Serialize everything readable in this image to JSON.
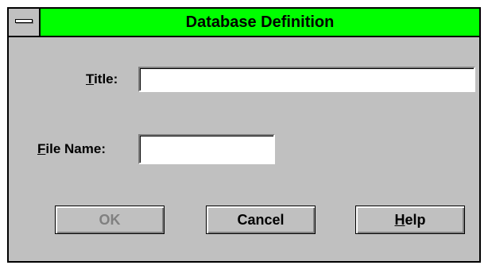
{
  "dialog": {
    "title": "Database Definition",
    "title_color": "#00ff00",
    "background_color": "#c0c0c0"
  },
  "fields": {
    "title": {
      "label_mnemonic": "T",
      "label_rest": "itle:",
      "value": ""
    },
    "file_name": {
      "label_mnemonic": "F",
      "label_rest": "ile Name:",
      "value": ""
    }
  },
  "buttons": {
    "ok": {
      "label": "OK",
      "enabled": false
    },
    "cancel": {
      "label": "Cancel",
      "enabled": true
    },
    "help": {
      "label_mnemonic": "H",
      "label_rest": "elp",
      "enabled": true
    }
  }
}
